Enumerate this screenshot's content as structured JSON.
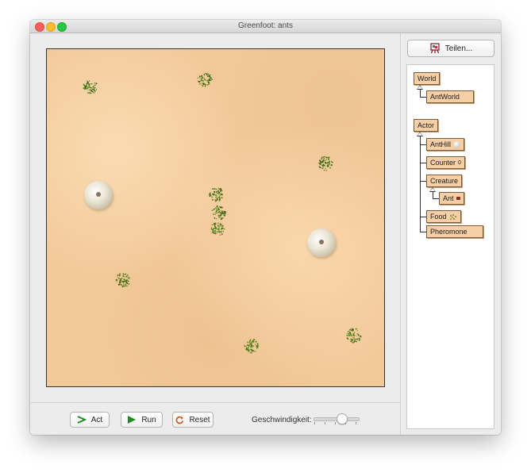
{
  "window": {
    "title": "Greenfoot: ants"
  },
  "controls": {
    "act_label": "Act",
    "run_label": "Run",
    "reset_label": "Reset",
    "speed_label": "Geschwindigkeit:",
    "speed_value": 0.65
  },
  "sidebar": {
    "share_label": "Teilen...",
    "classes": {
      "world": "World",
      "antworld": "AntWorld",
      "actor": "Actor",
      "anthill": "AntHill",
      "counter": "Counter",
      "counter_value": "0",
      "creature": "Creature",
      "ant": "Ant",
      "food": "Food",
      "pheromone": "Pheromone"
    }
  },
  "colors": {
    "sand": "#f3c99a",
    "food": "#3f6b14",
    "class_box": "#f6cfa7",
    "run_arrow": "#1f8a1f",
    "reset_arrow": "#c0541a"
  }
}
